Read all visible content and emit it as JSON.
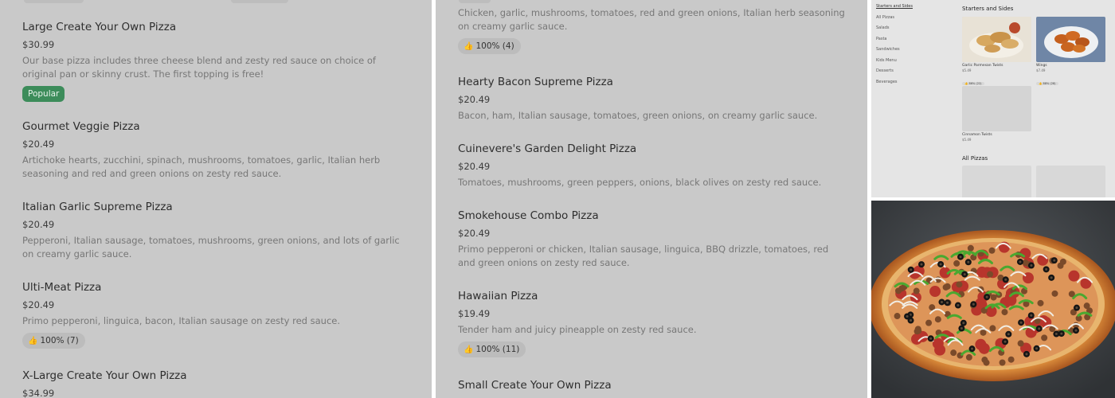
{
  "column_left": {
    "items": [
      {
        "name": "Large Create Your Own Pizza",
        "price": "$30.99",
        "description": "Our base pizza includes three cheese blend and zesty red sauce on choice of original pan or skinny crust. The first topping is free!",
        "badge": "Popular"
      },
      {
        "name": "Gourmet Veggie Pizza",
        "price": "$20.49",
        "description": "Artichoke hearts, zucchini, spinach, mushrooms, tomatoes, garlic, Italian herb seasoning and red and green onions on zesty red sauce."
      },
      {
        "name": "Italian Garlic Supreme Pizza",
        "price": "$20.49",
        "description": "Pepperoni, Italian sausage, tomatoes, mushrooms, green onions, and lots of garlic on creamy garlic sauce."
      },
      {
        "name": "Ulti-Meat Pizza",
        "price": "$20.49",
        "description": "Primo pepperoni, linguica, bacon, Italian sausage on zesty red sauce.",
        "rating": "100% (7)"
      },
      {
        "name": "X-Large Create Your Own Pizza",
        "price": "$34.99"
      }
    ]
  },
  "column_middle": {
    "items": [
      {
        "description": "Chicken, garlic, mushrooms, tomatoes, red and green onions, Italian herb seasoning on creamy garlic sauce.",
        "rating": "100% (4)"
      },
      {
        "name": "Hearty Bacon Supreme Pizza",
        "price": "$20.49",
        "description": "Bacon, ham, Italian sausage, tomatoes, green onions, on creamy garlic sauce."
      },
      {
        "name": "Cuinevere's Garden Delight Pizza",
        "price": "$20.49",
        "description": "Tomatoes, mushrooms, green peppers, onions, black olives on zesty red sauce."
      },
      {
        "name": "Smokehouse Combo Pizza",
        "price": "$20.49",
        "description": "Primo pepperoni or chicken, Italian sausage, linguica, BBQ drizzle, tomatoes, red and green onions on zesty red sauce."
      },
      {
        "name": "Hawaiian Pizza",
        "price": "$19.49",
        "description": "Tender ham and juicy pineapple on zesty red sauce.",
        "rating": "100% (11)"
      },
      {
        "name": "Small Create Your Own Pizza"
      }
    ]
  },
  "mini_screenshot": {
    "nav": [
      "Starters and Sides",
      "All Pizzas",
      "Salads",
      "Pasta",
      "Sandwiches",
      "Kids Menu",
      "Desserts",
      "Beverages"
    ],
    "section_title": "Starters and Sides",
    "cards": [
      {
        "name": "Garlic Parmesan Twists",
        "price": "$5.49",
        "rating": "👍 86% (22)"
      },
      {
        "name": "Wings",
        "price": "$7.49",
        "rating": "👍 88% (28)"
      },
      {
        "name": "Cinnamon Twists",
        "price": "$5.49"
      }
    ],
    "section_title_2": "All Pizzas"
  },
  "icons": {
    "thumbs_up": "👍"
  },
  "colors": {
    "panel_bg": "#c9c9c9",
    "popular_badge": "#3c8c5a",
    "chip_bg": "#bcbcbc"
  }
}
